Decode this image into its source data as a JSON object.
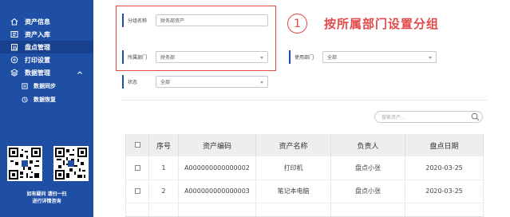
{
  "sidebar": {
    "items": [
      {
        "label": "资产信息",
        "icon": "home-icon"
      },
      {
        "label": "资产入库",
        "icon": "inbox-icon"
      },
      {
        "label": "盘点管理",
        "icon": "clipboard-icon",
        "active": true
      },
      {
        "label": "打印设置",
        "icon": "printer-icon"
      },
      {
        "label": "数据管理",
        "icon": "layers-icon",
        "expanded": true
      },
      {
        "label": "数据同步",
        "icon": "sync-icon"
      },
      {
        "label": "数据恢复",
        "icon": "restore-icon"
      }
    ],
    "qr_caption_line1": "如有疑问 请扫一扫",
    "qr_caption_line2": "进行详情咨询"
  },
  "filters": {
    "name_label": "分组名称",
    "name_value": "财务部资产",
    "dept_label": "所属部门",
    "dept_value": "财务部",
    "user_label": "使用部门",
    "user_value": "全部",
    "status_label": "状态",
    "status_value": "全部"
  },
  "annotation": {
    "number": "1",
    "text": "按所属部门设置分组"
  },
  "search": {
    "placeholder": "搜索资产..."
  },
  "table": {
    "headers": [
      "序号",
      "资产编码",
      "资产名称",
      "负责人",
      "盘点日期"
    ],
    "rows": [
      [
        "1",
        "A000000000000002",
        "打印机",
        "盘点小张",
        "2020-03-25"
      ],
      [
        "2",
        "A000000000000003",
        "笔记本电脑",
        "盘点小张",
        "2020-03-25"
      ]
    ]
  },
  "colors": {
    "sidebar_bg": "#1f4fa5",
    "sidebar_active": "#17408e",
    "annotation_red": "#e24a4a",
    "header_bg": "#eeeeee"
  }
}
